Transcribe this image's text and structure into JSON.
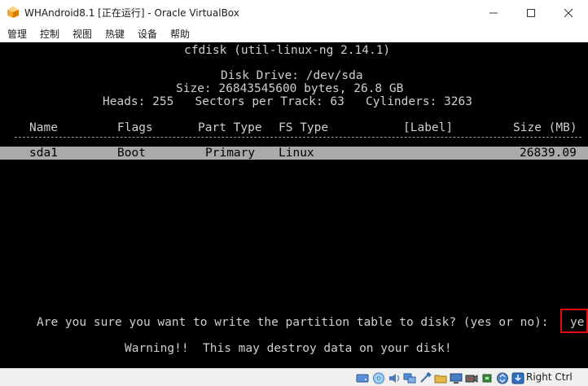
{
  "window": {
    "title": "WHAndroid8.1 [正在运行] - Oracle VirtualBox"
  },
  "menu": {
    "items": [
      "管理",
      "控制",
      "视图",
      "热键",
      "设备",
      "帮助"
    ]
  },
  "console": {
    "program_title": "cfdisk (util-linux-ng 2.14.1)",
    "disk_drive": "Disk Drive: /dev/sda",
    "size_line": "Size: 26843545600 bytes, 26.8 GB",
    "geometry_line": "Heads: 255   Sectors per Track: 63   Cylinders: 3263",
    "columns": {
      "name": "Name",
      "flags": "Flags",
      "part_type": "Part Type",
      "fs_type": "FS Type",
      "label": "[Label]",
      "size": "Size (MB)"
    },
    "partition": {
      "name": "sda1",
      "flags": "Boot",
      "part_type": "Primary",
      "fs_type": "Linux",
      "size": "26839.09"
    },
    "prompt": "Are you sure you want to write the partition table to disk? (yes or no):",
    "answer": "ye",
    "warning": "Warning!!  This may destroy data on your disk!"
  },
  "statusbar": {
    "host_key": "Right Ctrl",
    "icons": [
      "hard-disk-icon",
      "optical-drive-icon",
      "audio-icon",
      "network-icon",
      "usb-icon",
      "shared-folders-icon",
      "display-icon",
      "video-capture-icon",
      "cpu-icon",
      "mouse-integration-icon",
      "host-key-arrow-icon"
    ]
  }
}
